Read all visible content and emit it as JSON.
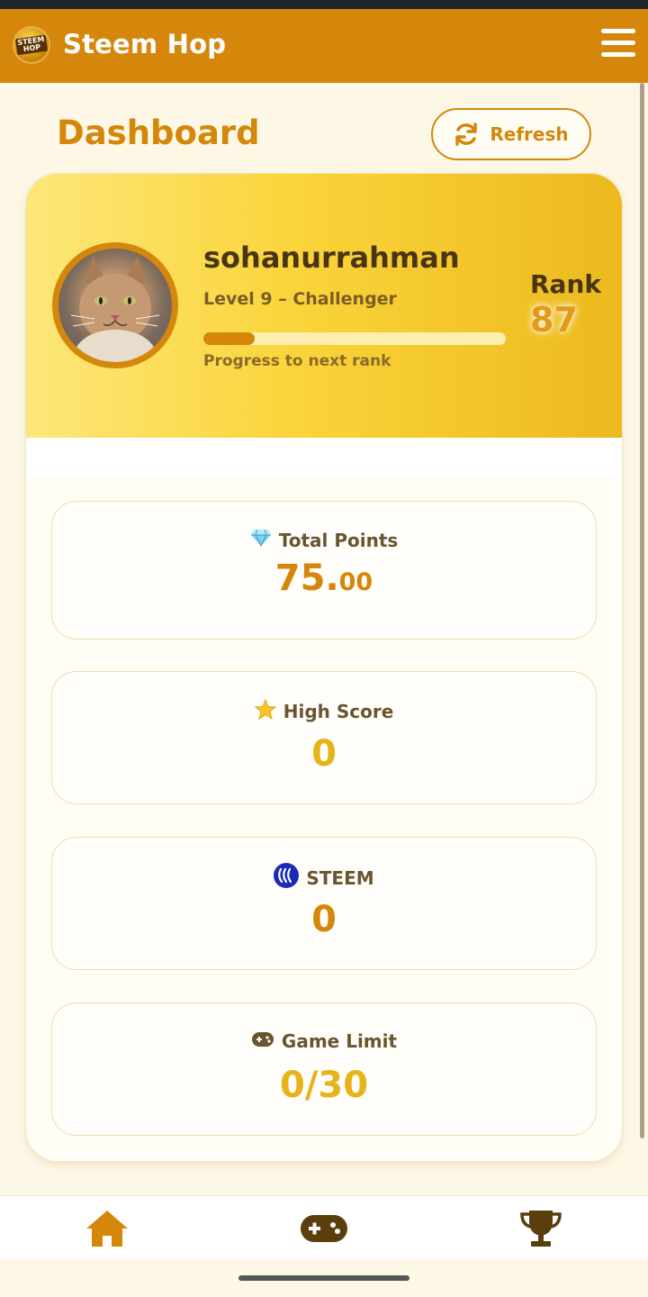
{
  "app": {
    "title": "Steem Hop",
    "logo_text": "STEEM HOP"
  },
  "header": {
    "page_title": "Dashboard",
    "refresh_label": "Refresh"
  },
  "profile": {
    "username": "sohanurrahman",
    "level": "Level 9 – Challenger",
    "progress_fraction": 0.17,
    "progress_caption": "Progress to next rank",
    "rank_label": "Rank",
    "rank_value": "87"
  },
  "stats": [
    {
      "icon": "diamond-icon",
      "label": "Total Points",
      "value_main": "75.",
      "value_dec": "00",
      "color": "#d4870a"
    },
    {
      "icon": "star-icon",
      "label": "High Score",
      "value_main": "0",
      "value_dec": "",
      "color": "#e6b31a"
    },
    {
      "icon": "steem-icon",
      "label": "STEEM",
      "value_main": "0",
      "value_dec": "",
      "color": "#d4870a"
    },
    {
      "icon": "gamepad-icon",
      "label": "Game Limit",
      "value_main": "0/30",
      "value_dec": "",
      "color": "#e6b31a"
    }
  ],
  "nav": {
    "items": [
      "home-icon",
      "gamepad-icon",
      "trophy-icon"
    ],
    "active": "home-icon"
  },
  "colors": {
    "primary": "#d4870a",
    "background": "#fdf8e6",
    "accent_yellow": "#fad43a",
    "steem_blue": "#1a2bb5"
  }
}
